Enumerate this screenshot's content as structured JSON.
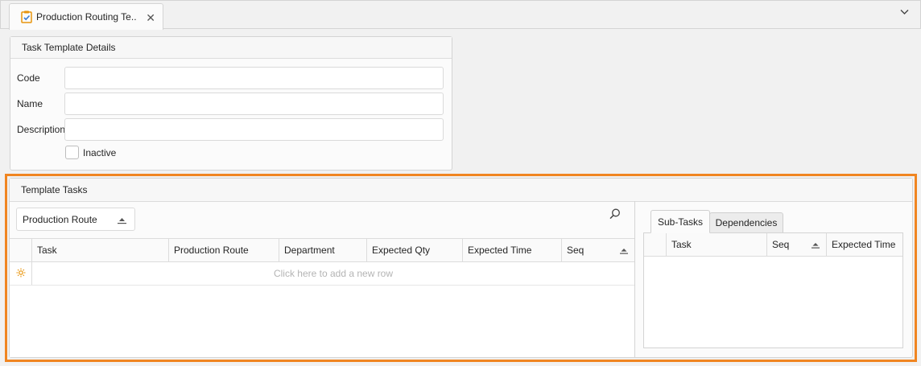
{
  "tabs": {
    "active_tab_label": "Production Routing Te..."
  },
  "details": {
    "title": "Task Template Details",
    "code_label": "Code",
    "name_label": "Name",
    "description_label": "Description",
    "inactive_label": "Inactive"
  },
  "template_tasks": {
    "title": "Template Tasks",
    "group_button_label": "Production Route",
    "columns": [
      "Task",
      "Production Route",
      "Department",
      "Expected Qty",
      "Expected Time",
      "Seq"
    ],
    "new_row_text": "Click here to add a new row"
  },
  "subpanel": {
    "tabs": [
      "Sub-Tasks",
      "Dependencies"
    ],
    "columns": [
      "Task",
      "Seq",
      "Expected Time"
    ]
  },
  "colors": {
    "highlight": "#f08521",
    "icon_orange": "#e8940c"
  }
}
